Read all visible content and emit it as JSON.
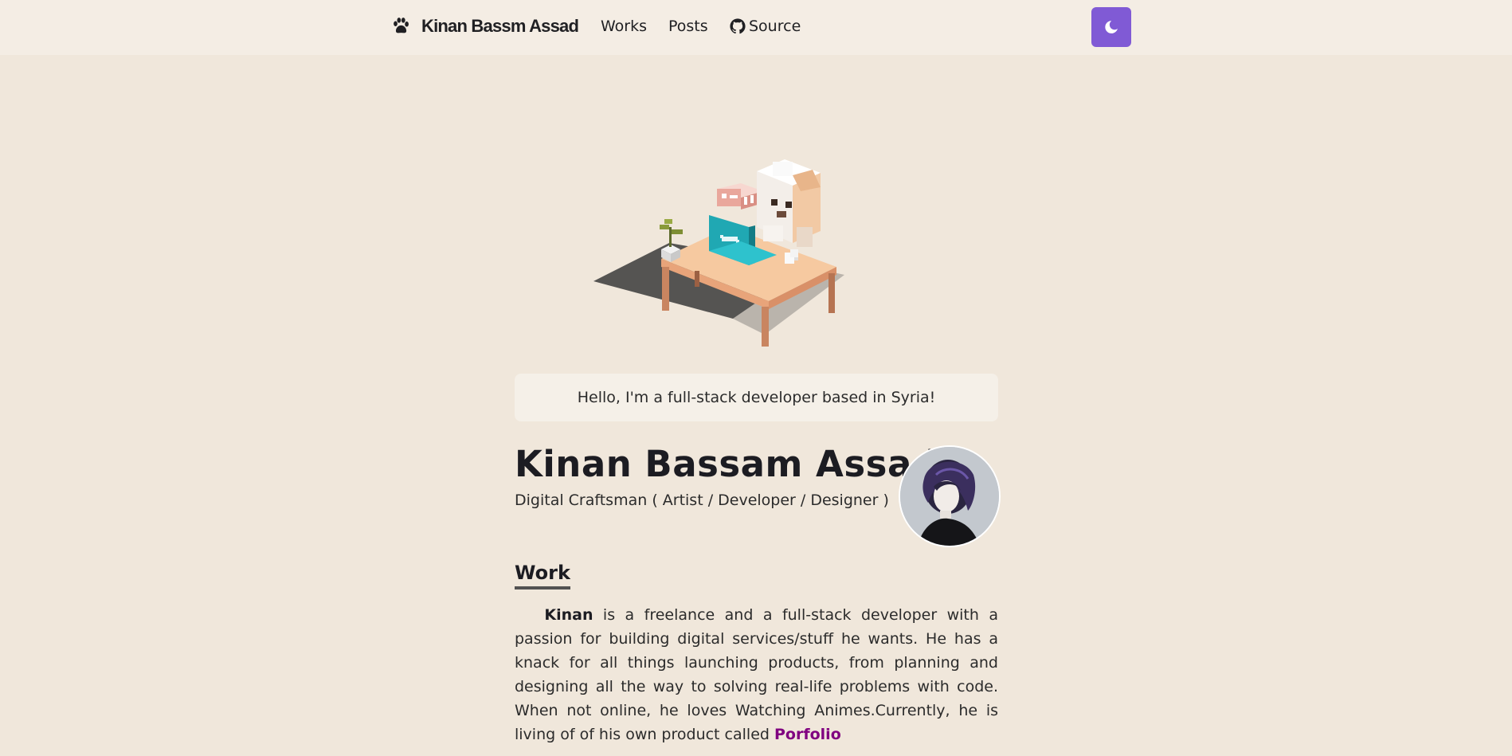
{
  "navbar": {
    "brand_name": "Kinan Bassm Assad",
    "links": [
      {
        "label": "Works"
      },
      {
        "label": "Posts"
      },
      {
        "label": "Source",
        "icon": "github-icon"
      }
    ],
    "theme_toggle_icon": "moon-icon",
    "accent_color": "#805ad5"
  },
  "hero": {
    "greeting": "Hello, I'm a full-stack developer based in Syria!"
  },
  "profile": {
    "name": "Kinan Bassam Assad",
    "subtitle": "Digital Craftsman ( Artist / Developer / Designer )"
  },
  "work": {
    "title": "Work",
    "bio_name": "Kinan",
    "bio_text": " is a freelance and a full-stack developer with a passion for building digital services/stuff he wants. He has a knack for all things launching products, from planning and designing all the way to solving real-life problems with code. When not online, he loves Watching Animes.Currently, he is living of of his own product called ",
    "link_label": "Porfolio"
  },
  "colors": {
    "background": "#f0e7db",
    "navbar": "#f4ede4",
    "link": "#800080"
  }
}
